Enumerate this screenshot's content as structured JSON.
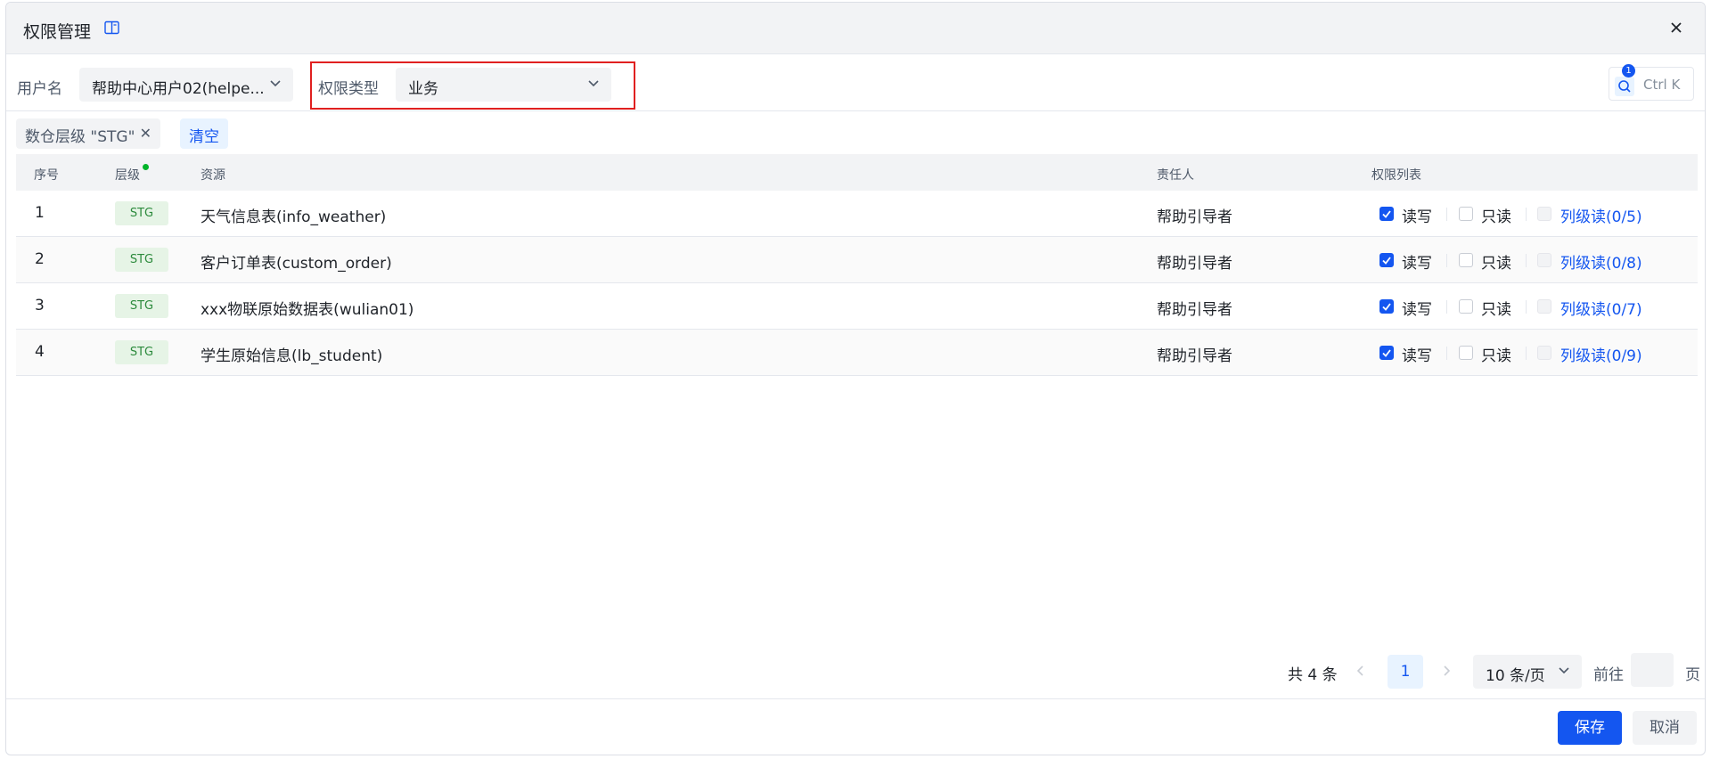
{
  "dialog": {
    "title": "权限管理",
    "icons": {
      "doc": "book-icon",
      "close": "close-icon"
    }
  },
  "filters": {
    "username_label": "用户名",
    "username_value": "帮助中心用户02(helpe...",
    "permtype_label": "权限类型",
    "permtype_value": "业务",
    "search_badge": "1",
    "search_shortcut": "Ctrl K"
  },
  "tags": {
    "filter_tag": "数仓层级 \"STG\"",
    "clear_label": "清空"
  },
  "table": {
    "headers": {
      "index": "序号",
      "level": "层级",
      "resource": "资源",
      "owner": "责任人",
      "perms": "权限列表"
    },
    "rows": [
      {
        "index": "1",
        "level": "STG",
        "resource": "天气信息表(info_weather)",
        "owner": "帮助引导者",
        "rw": "读写",
        "ro": "只读",
        "col": "列级读(0/5)",
        "rw_checked": true
      },
      {
        "index": "2",
        "level": "STG",
        "resource": "客户订单表(custom_order)",
        "owner": "帮助引导者",
        "rw": "读写",
        "ro": "只读",
        "col": "列级读(0/8)",
        "rw_checked": true
      },
      {
        "index": "3",
        "level": "STG",
        "resource": "xxx物联原始数据表(wulian01)",
        "owner": "帮助引导者",
        "rw": "读写",
        "ro": "只读",
        "col": "列级读(0/7)",
        "rw_checked": true
      },
      {
        "index": "4",
        "level": "STG",
        "resource": "学生原始信息(lb_student)",
        "owner": "帮助引导者",
        "rw": "读写",
        "ro": "只读",
        "col": "列级读(0/9)",
        "rw_checked": true
      }
    ]
  },
  "pagination": {
    "total": "共 4 条",
    "current_page": "1",
    "page_size": "10 条/页",
    "goto_label": "前往",
    "page_suffix": "页"
  },
  "footer": {
    "save": "保存",
    "cancel": "取消"
  },
  "colors": {
    "accent": "#1456f0",
    "highlight": "#e02020",
    "level_tag_bg": "#e6f4e6"
  }
}
